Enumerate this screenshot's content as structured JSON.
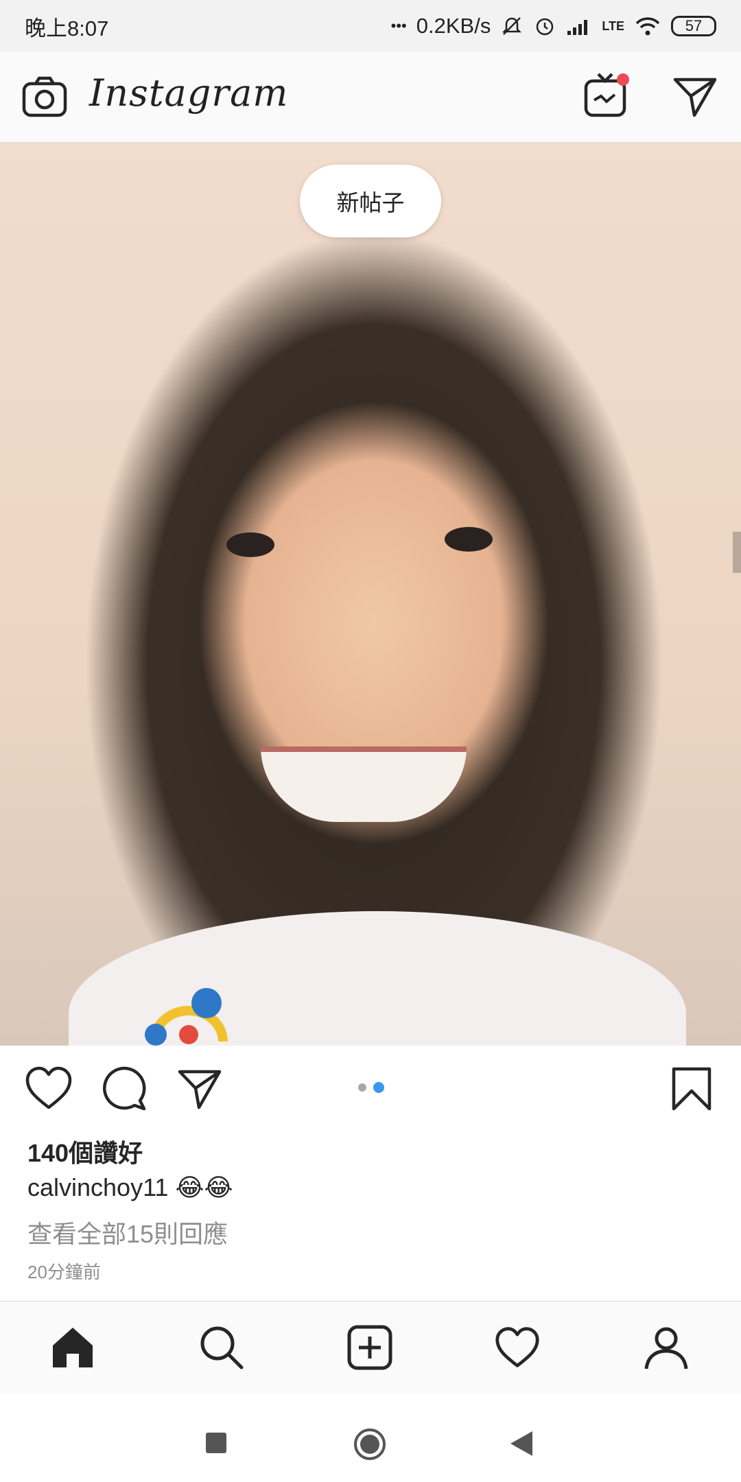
{
  "status_bar": {
    "time": "晚上8:07",
    "dots": "•••",
    "net_speed": "0.2KB/s",
    "lte": "LTE",
    "battery": "57"
  },
  "header": {
    "logo": "Instagram"
  },
  "post": {
    "new_posts_label": "新帖子",
    "carousel_pages": 2,
    "carousel_active": 2,
    "likes": "140個讚好",
    "username": "calvinchoy11",
    "caption_text": "😂😂",
    "view_comments": "查看全部15則回應",
    "time_ago": "20分鐘前"
  },
  "colors": {
    "accent": "#3897f0",
    "notification": "#ed4956"
  },
  "tabs": [
    {
      "icon": "home-icon"
    },
    {
      "icon": "search-icon"
    },
    {
      "icon": "add-post-icon"
    },
    {
      "icon": "heart-icon"
    },
    {
      "icon": "profile-icon"
    }
  ],
  "system_nav": [
    {
      "icon": "recents-square-icon"
    },
    {
      "icon": "home-circle-icon"
    },
    {
      "icon": "back-triangle-icon"
    }
  ]
}
